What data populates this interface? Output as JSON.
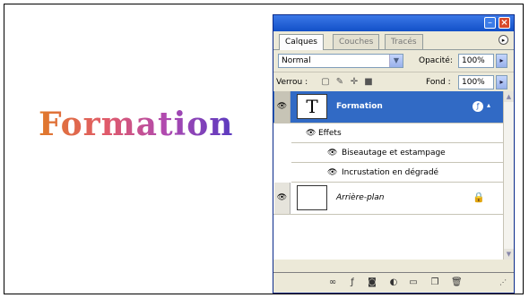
{
  "slide": {
    "wordart_text": "Formation"
  },
  "panel": {
    "tabs": [
      "Calques",
      "Couches",
      "Tracés"
    ],
    "active_tab": "Calques",
    "blend_mode": "Normal",
    "opacity_label": "Opacité:",
    "opacity_value": "100%",
    "lock_label": "Verrou :",
    "fill_label": "Fond :",
    "fill_value": "100%",
    "layers": {
      "formation": {
        "name": "Formation",
        "thumb_glyph": "T"
      },
      "effects_label": "Effets",
      "effect_1": "Biseautage et estampage",
      "effect_2": "Incrustation en dégradé",
      "background": {
        "name": "Arrière-plan"
      }
    },
    "colors": {
      "selected_row": "#316ac5",
      "title_bar": "#1e5ad8",
      "panel_bg": "#ece9d8"
    }
  }
}
